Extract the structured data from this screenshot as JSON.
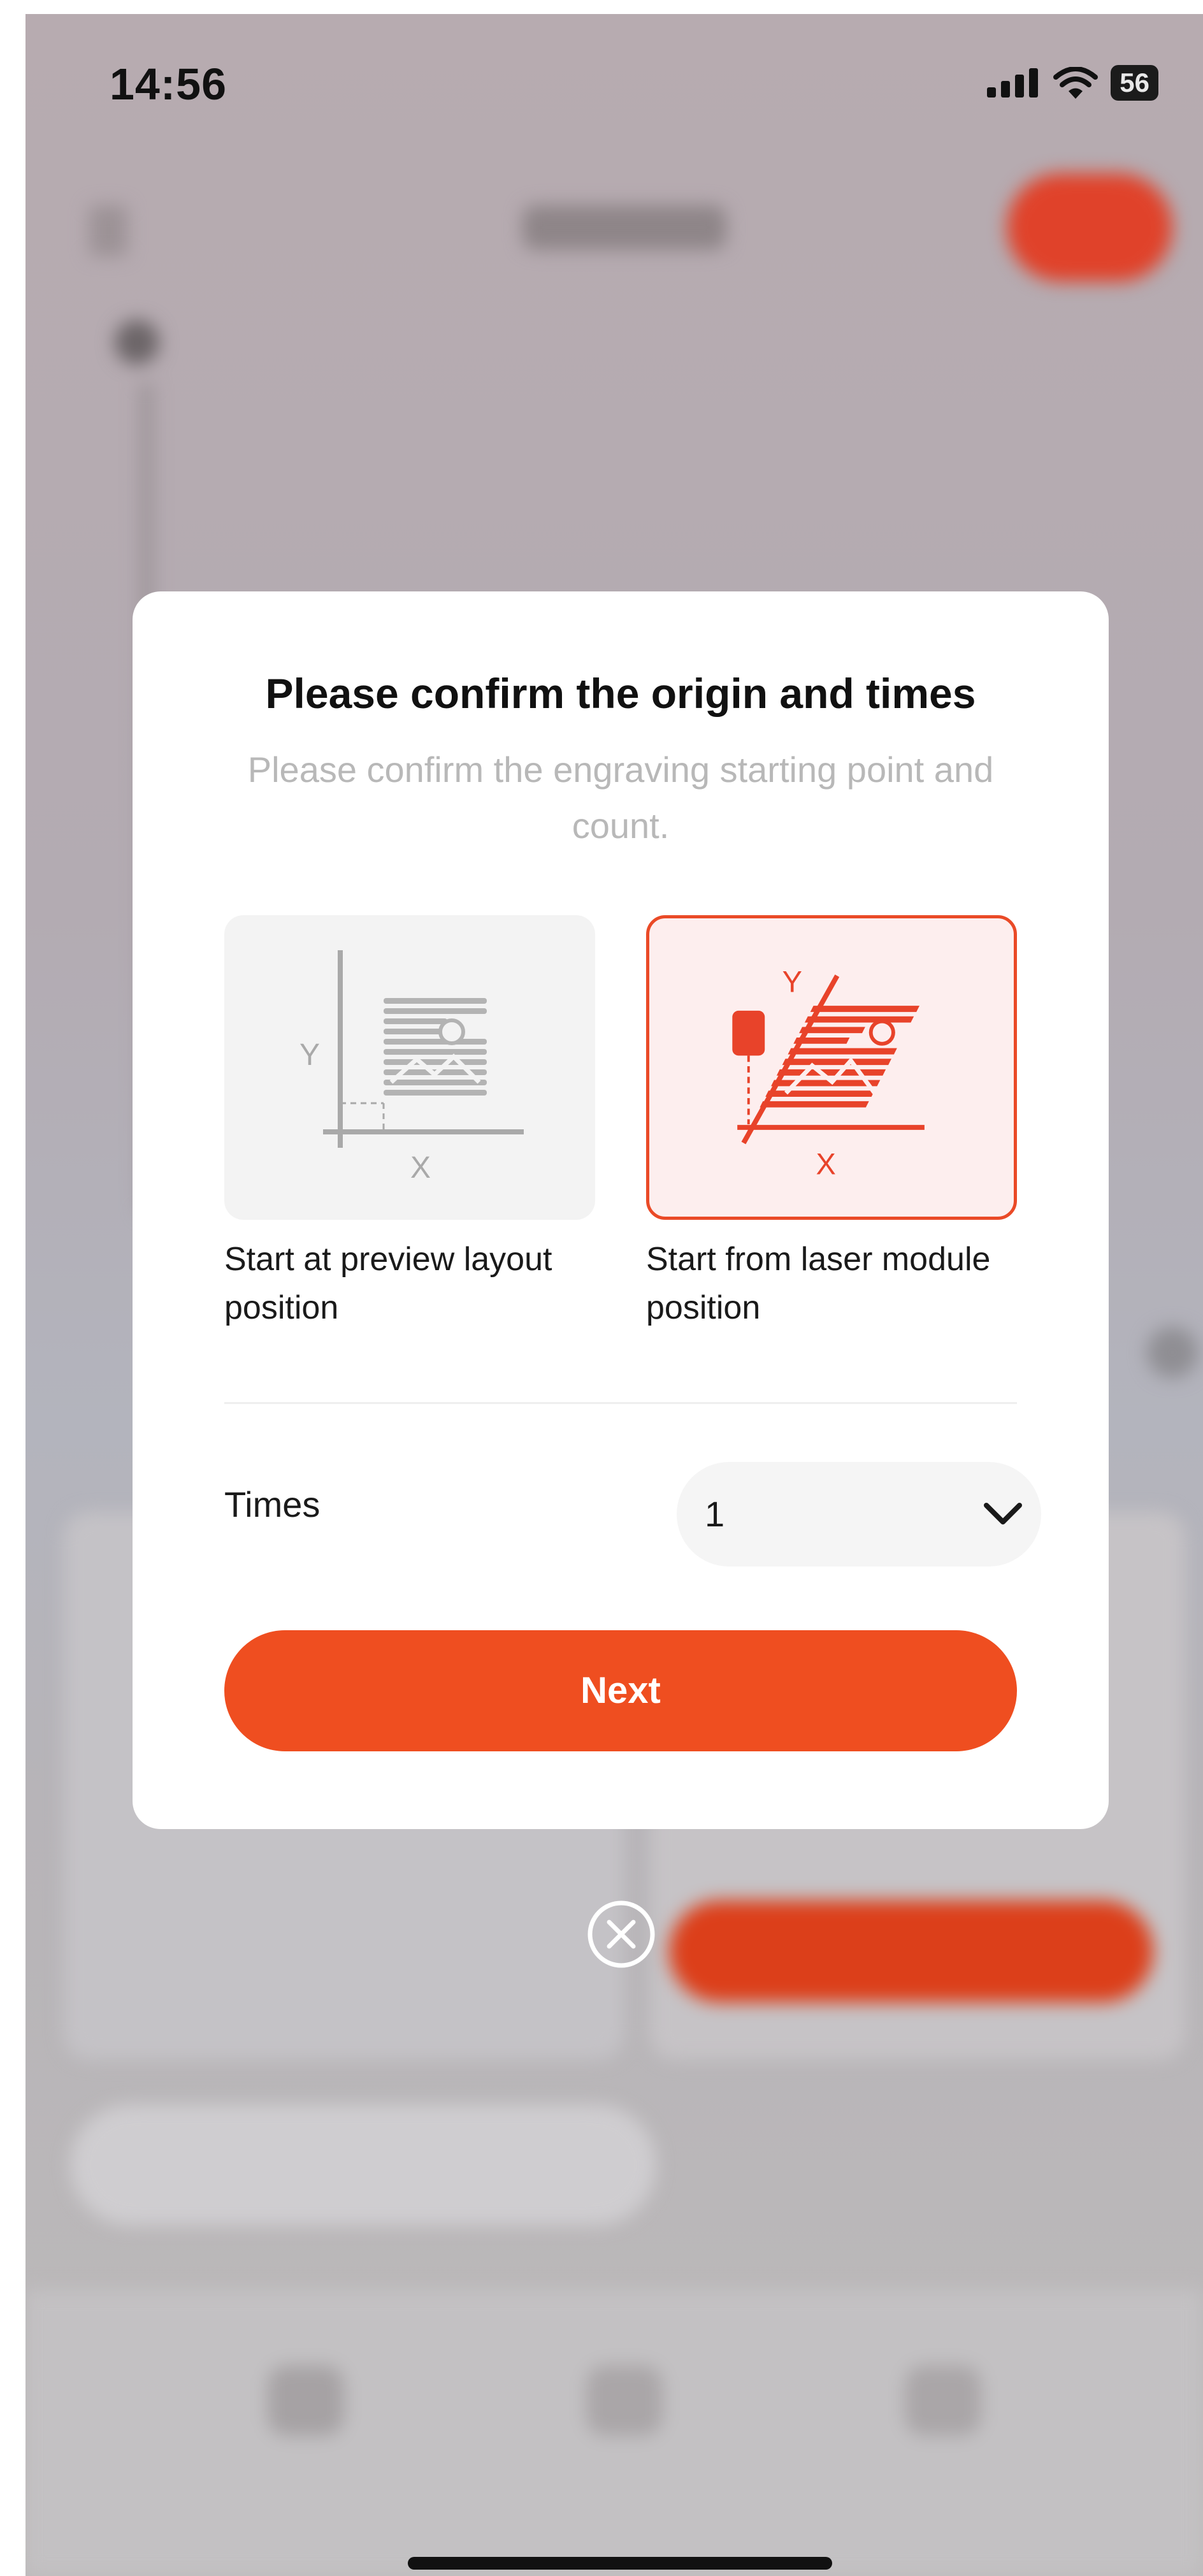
{
  "status_bar": {
    "time": "14:56",
    "battery": "56",
    "icons": [
      "cellular-signal-icon",
      "wifi-icon",
      "battery-icon"
    ]
  },
  "dialog": {
    "title": "Please confirm the origin and times",
    "subtitle": "Please confirm the engraving starting point and count.",
    "options": [
      {
        "label": "Start at preview layout position",
        "selected": false,
        "axis_x": "X",
        "axis_y": "Y"
      },
      {
        "label": "Start from laser module position",
        "selected": true,
        "axis_x": "X",
        "axis_y": "Y"
      }
    ],
    "times_label": "Times",
    "times_value": "1",
    "next_label": "Next"
  },
  "colors": {
    "accent": "#ef4e20",
    "selected_border": "#ea4a27",
    "selected_bg": "#fdeeee"
  }
}
